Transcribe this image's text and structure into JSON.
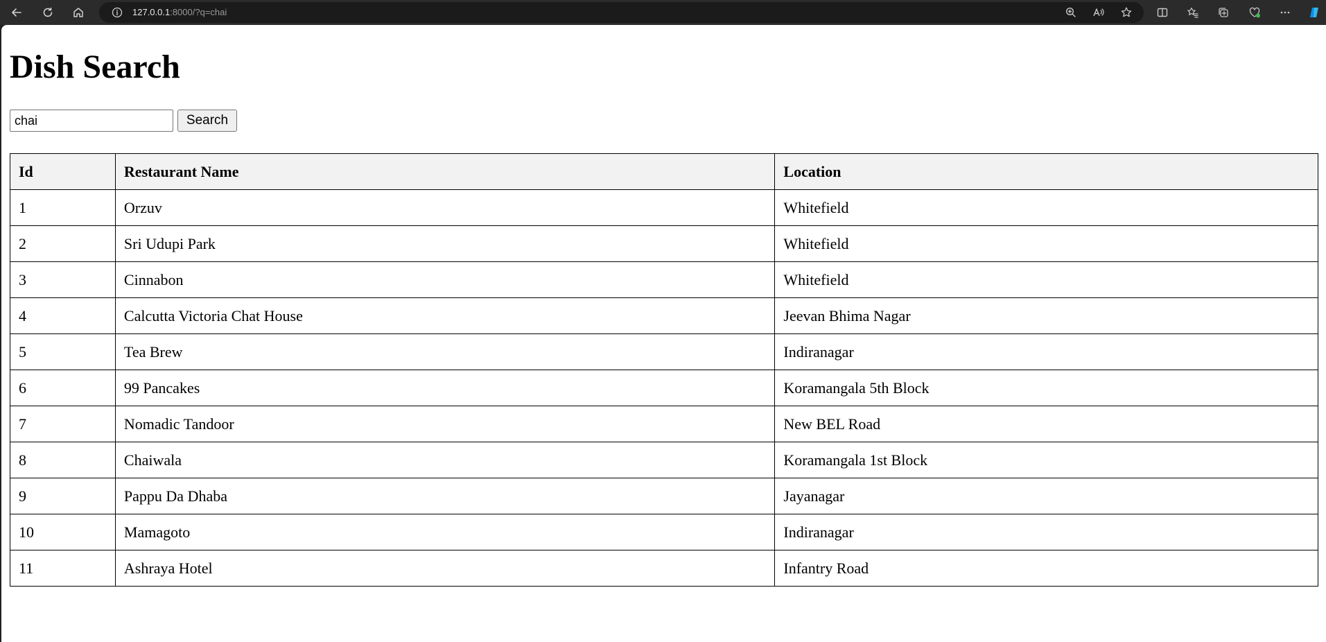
{
  "browser": {
    "address": {
      "host": "127.0.0.1",
      "rest": ":8000/?q=chai"
    }
  },
  "page": {
    "title": "Dish Search",
    "search": {
      "value": "chai",
      "button_label": "Search"
    },
    "table": {
      "headers": {
        "id": "Id",
        "name": "Restaurant Name",
        "location": "Location"
      },
      "rows": [
        {
          "id": "1",
          "name": "Orzuv",
          "location": "Whitefield"
        },
        {
          "id": "2",
          "name": "Sri Udupi Park",
          "location": "Whitefield"
        },
        {
          "id": "3",
          "name": "Cinnabon",
          "location": "Whitefield"
        },
        {
          "id": "4",
          "name": "Calcutta Victoria Chat House",
          "location": "Jeevan Bhima Nagar"
        },
        {
          "id": "5",
          "name": "Tea Brew",
          "location": "Indiranagar"
        },
        {
          "id": "6",
          "name": "99 Pancakes",
          "location": "Koramangala 5th Block"
        },
        {
          "id": "7",
          "name": "Nomadic Tandoor",
          "location": "New BEL Road"
        },
        {
          "id": "8",
          "name": "Chaiwala",
          "location": "Koramangala 1st Block"
        },
        {
          "id": "9",
          "name": "Pappu Da Dhaba",
          "location": "Jayanagar"
        },
        {
          "id": "10",
          "name": "Mamagoto",
          "location": "Indiranagar"
        },
        {
          "id": "11",
          "name": "Ashraya Hotel",
          "location": "Infantry Road"
        }
      ]
    }
  },
  "colors": {
    "chrome_bg": "#2b2b2b",
    "address_bg": "#1b1b1b",
    "header_cell_bg": "#f2f2f2",
    "copilot_accent": "#0f8ee9"
  }
}
